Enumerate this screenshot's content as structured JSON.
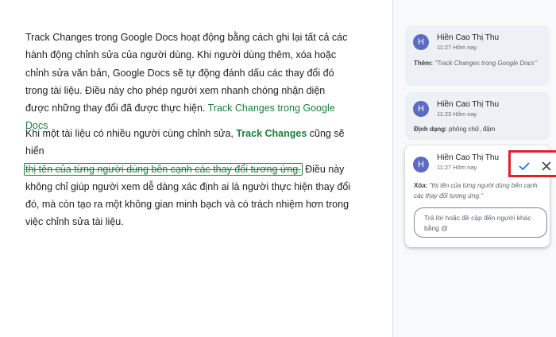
{
  "document": {
    "p1": {
      "text": "Track Changes trong Google Docs hoạt động bằng cách ghi lại tất cả các hành động chỉnh sửa của người dùng. Khi người dùng thêm, xóa hoặc chỉnh sửa văn bản, Google Docs sẽ tự động đánh dấu các thay đổi đó trong tài liệu. Điều này cho phép người xem nhanh chóng nhận diện được những thay đổi đã được thực hiện.",
      "inserted": "Track Changes trong Google Docs"
    },
    "p2": {
      "before": "Khi một tài liệu có nhiều người cùng chỉnh sửa, ",
      "formatted": "Track Changes",
      "mid": " cũng sẽ hiển",
      "deleted": "thị tên của từng người dùng bên cạnh các thay đổi tương ứng.",
      "after": " Điều này không chỉ giúp người xem dễ dàng xác định ai là người thực hiện thay đổi đó, mà còn tạo ra một không gian minh bạch và có trách nhiệm hơn trong việc chỉnh sửa tài liệu."
    }
  },
  "comments": [
    {
      "initial": "H",
      "author": "Hiền Cao Thị Thu",
      "time": "11:27 Hôm nay",
      "label": "Thêm:",
      "content": "\"Track Changes trong Google Docs\""
    },
    {
      "initial": "H",
      "author": "Hiền Cao Thị Thu",
      "time": "11:23 Hôm nay",
      "label": "Định dạng:",
      "content": "phông chữ, đậm"
    },
    {
      "initial": "H",
      "author": "Hiền Cao Thị Thu",
      "time": "11:27 Hôm nay",
      "label": "Xóa:",
      "content": "\"thị tên của từng người dùng bên cạnh các thay đổi tương ứng.\"",
      "reply_placeholder": "Trả lời hoặc đề cập đến người khác bằng @",
      "accept_icon": "check-icon",
      "reject_icon": "close-icon"
    }
  ],
  "colors": {
    "inserted_text": "#188038",
    "avatar": "#5c6bc0",
    "accept": "#1a73e8",
    "highlight_box": "#e3202a"
  }
}
